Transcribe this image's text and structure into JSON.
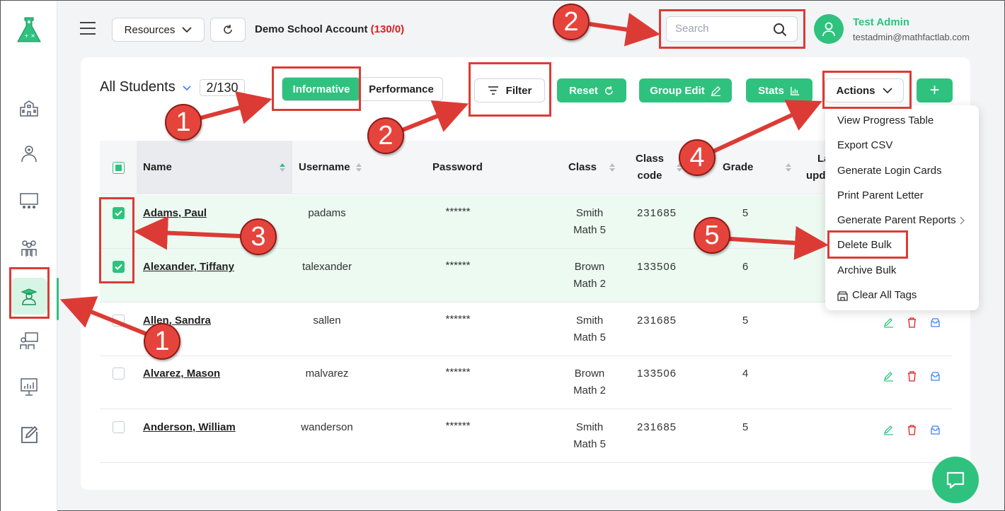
{
  "header": {
    "resources_label": "Resources",
    "school_name": "Demo School Account",
    "school_count": "(130/0)",
    "search_placeholder": "Search",
    "user_name": "Test Admin",
    "user_email": "testadmin@mathfactlab.com"
  },
  "toolbar": {
    "title": "All Students",
    "count": "2/130",
    "view_informative": "Informative",
    "view_performance": "Performance",
    "filter_label": "Filter",
    "reset_label": "Reset",
    "group_edit_label": "Group Edit",
    "stats_label": "Stats",
    "actions_label": "Actions",
    "add_label": "+"
  },
  "table": {
    "columns": {
      "name": "Name",
      "username": "Username",
      "password": "Password",
      "class": "Class",
      "class_code_1": "Class",
      "class_code_2": "code",
      "grade": "Grade",
      "last_1": "La",
      "last_2": "upd"
    },
    "rows": [
      {
        "name": "Adams, Paul",
        "username": "padams",
        "password": "******",
        "class_1": "Smith",
        "class_2": "Math 5",
        "code": "231685",
        "grade": "5",
        "selected": true
      },
      {
        "name": "Alexander, Tiffany",
        "username": "talexander",
        "password": "******",
        "class_1": "Brown",
        "class_2": "Math 2",
        "code": "133506",
        "grade": "6",
        "selected": true
      },
      {
        "name": "Allen, Sandra",
        "username": "sallen",
        "password": "******",
        "class_1": "Smith",
        "class_2": "Math 5",
        "code": "231685",
        "grade": "5",
        "selected": false
      },
      {
        "name": "Alvarez, Mason",
        "username": "malvarez",
        "password": "******",
        "class_1": "Brown",
        "class_2": "Math 2",
        "code": "133506",
        "grade": "4",
        "selected": false
      },
      {
        "name": "Anderson, William",
        "username": "wanderson",
        "password": "******",
        "class_1": "Smith",
        "class_2": "Math 5",
        "code": "231685",
        "grade": "5",
        "selected": false
      }
    ]
  },
  "actions_menu": {
    "items": [
      "View Progress Table",
      "Export CSV",
      "Generate Login Cards",
      "Print Parent Letter",
      "Generate Parent Reports",
      "Delete Bulk",
      "Archive Bulk",
      "Clear All Tags"
    ]
  },
  "annotations": {
    "step_1": "1",
    "step_2": "2",
    "step_3": "3",
    "step_4": "4",
    "step_5": "5"
  },
  "colors": {
    "accent": "#2ec27e",
    "annotation_red": "#dc3b35",
    "delete_red": "#e11d1d",
    "archive_blue": "#3b82f6"
  }
}
